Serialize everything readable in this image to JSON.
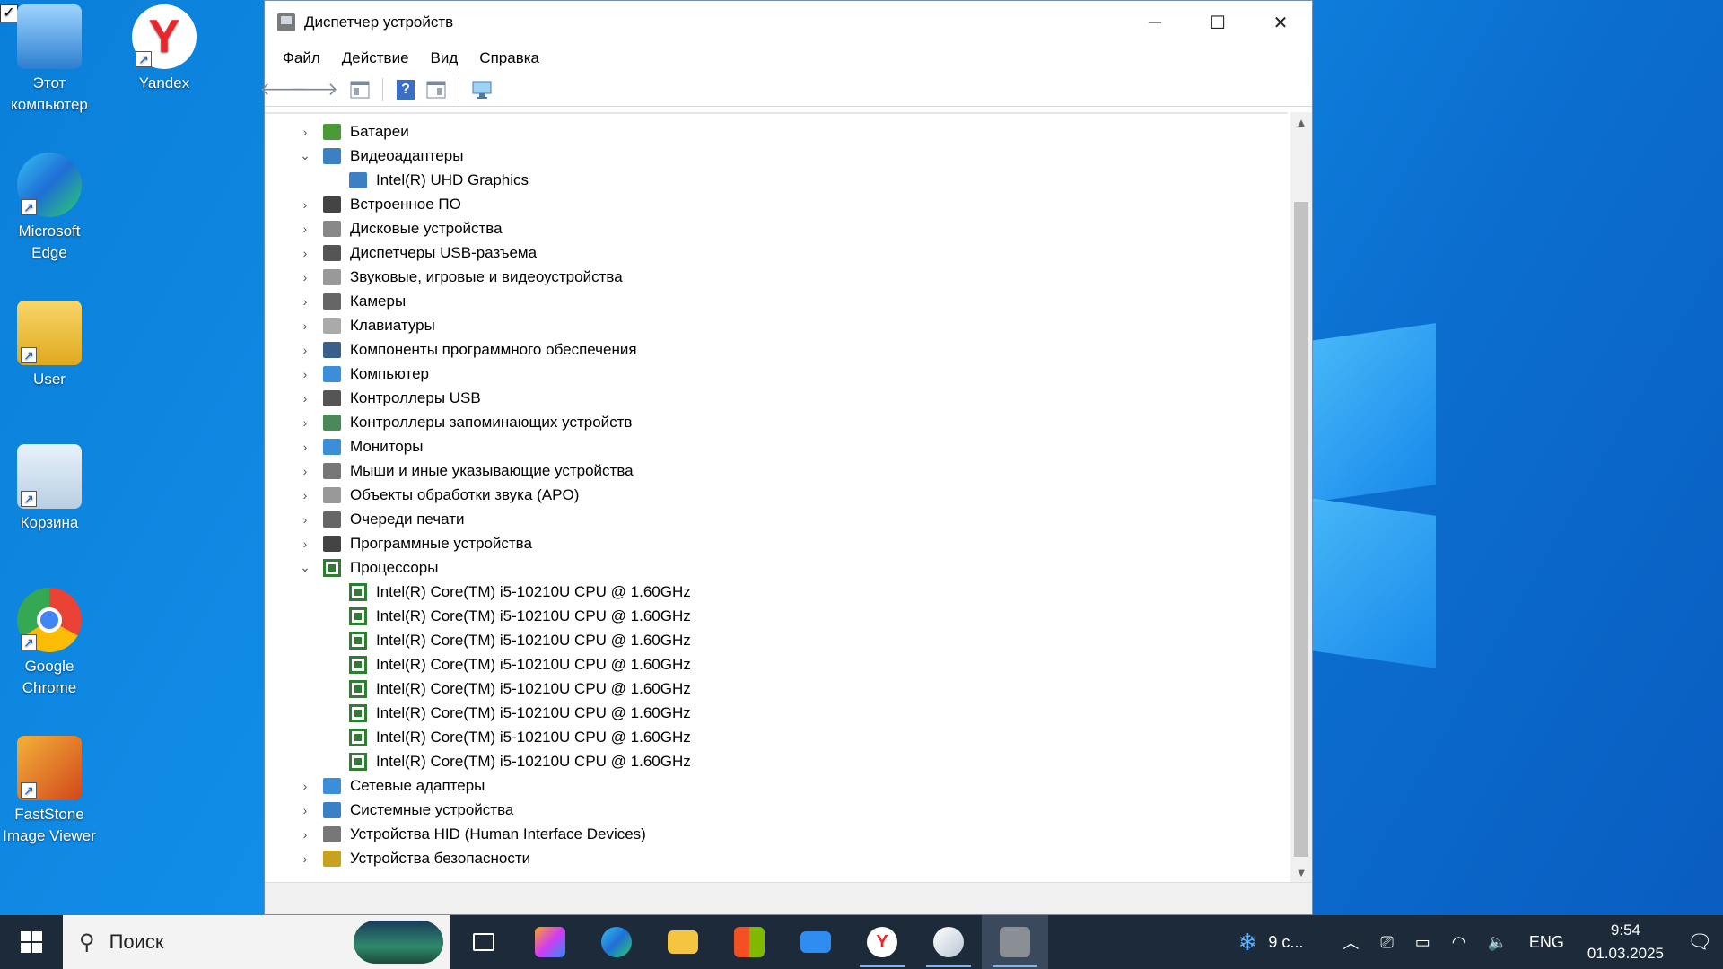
{
  "desktop": {
    "icons": [
      {
        "label": "Этот компьютер",
        "icon": "this-pc-icon"
      },
      {
        "label": "Yandex",
        "icon": "yandex-icon"
      },
      {
        "label": "Microsoft Edge",
        "icon": "edge-icon"
      },
      {
        "label": "User",
        "icon": "user-folder-icon"
      },
      {
        "label": "Корзина",
        "icon": "recycle-bin-icon"
      },
      {
        "label": "Google Chrome",
        "icon": "chrome-icon"
      },
      {
        "label": "FastStone Image Viewer",
        "icon": "faststone-icon"
      }
    ]
  },
  "window": {
    "title": "Диспетчер устройств",
    "controls": {
      "minimize": "─",
      "maximize": "☐",
      "close": "✕"
    },
    "menu": [
      "Файл",
      "Действие",
      "Вид",
      "Справка"
    ],
    "toolbar": {
      "back": "🡐",
      "forward": "🡒",
      "help": "?"
    }
  },
  "tree": {
    "categories": [
      {
        "label": "Батареи",
        "expanded": false,
        "color": "#4a9a3a"
      },
      {
        "label": "Видеоадаптеры",
        "expanded": true,
        "color": "#3b7fc4",
        "children": [
          "Intel(R) UHD Graphics"
        ]
      },
      {
        "label": "Встроенное ПО",
        "expanded": false,
        "color": "#444444"
      },
      {
        "label": "Дисковые устройства",
        "expanded": false,
        "color": "#888888"
      },
      {
        "label": "Диспетчеры USB-разъема",
        "expanded": false,
        "color": "#555555"
      },
      {
        "label": "Звуковые, игровые и видеоустройства",
        "expanded": false,
        "color": "#999999"
      },
      {
        "label": "Камеры",
        "expanded": false,
        "color": "#666666"
      },
      {
        "label": "Клавиатуры",
        "expanded": false,
        "color": "#aaaaaa"
      },
      {
        "label": "Компоненты программного обеспечения",
        "expanded": false,
        "color": "#3b5f8c"
      },
      {
        "label": "Компьютер",
        "expanded": false,
        "color": "#3b8fd9"
      },
      {
        "label": "Контроллеры USB",
        "expanded": false,
        "color": "#555555"
      },
      {
        "label": "Контроллеры запоминающих устройств",
        "expanded": false,
        "color": "#4a8a5a"
      },
      {
        "label": "Мониторы",
        "expanded": false,
        "color": "#3b8fd9"
      },
      {
        "label": "Мыши и иные указывающие устройства",
        "expanded": false,
        "color": "#777777"
      },
      {
        "label": "Объекты обработки звука (APO)",
        "expanded": false,
        "color": "#999999"
      },
      {
        "label": "Очереди печати",
        "expanded": false,
        "color": "#666666"
      },
      {
        "label": "Программные устройства",
        "expanded": false,
        "color": "#444444"
      },
      {
        "label": "Процессоры",
        "expanded": true,
        "color": "#2e7d32",
        "children": [
          "Intel(R) Core(TM) i5-10210U CPU @ 1.60GHz",
          "Intel(R) Core(TM) i5-10210U CPU @ 1.60GHz",
          "Intel(R) Core(TM) i5-10210U CPU @ 1.60GHz",
          "Intel(R) Core(TM) i5-10210U CPU @ 1.60GHz",
          "Intel(R) Core(TM) i5-10210U CPU @ 1.60GHz",
          "Intel(R) Core(TM) i5-10210U CPU @ 1.60GHz",
          "Intel(R) Core(TM) i5-10210U CPU @ 1.60GHz",
          "Intel(R) Core(TM) i5-10210U CPU @ 1.60GHz"
        ]
      },
      {
        "label": "Сетевые адаптеры",
        "expanded": false,
        "color": "#3b8fd9"
      },
      {
        "label": "Системные устройства",
        "expanded": false,
        "color": "#3b7fc4"
      },
      {
        "label": "Устройства HID (Human Interface Devices)",
        "expanded": false,
        "color": "#777777"
      },
      {
        "label": "Устройства безопасности",
        "expanded": false,
        "color": "#c9a020"
      }
    ]
  },
  "taskbar": {
    "search_placeholder": "Поиск",
    "weather": "9 с...",
    "language": "ENG",
    "time": "9:54",
    "date": "01.03.2025"
  }
}
